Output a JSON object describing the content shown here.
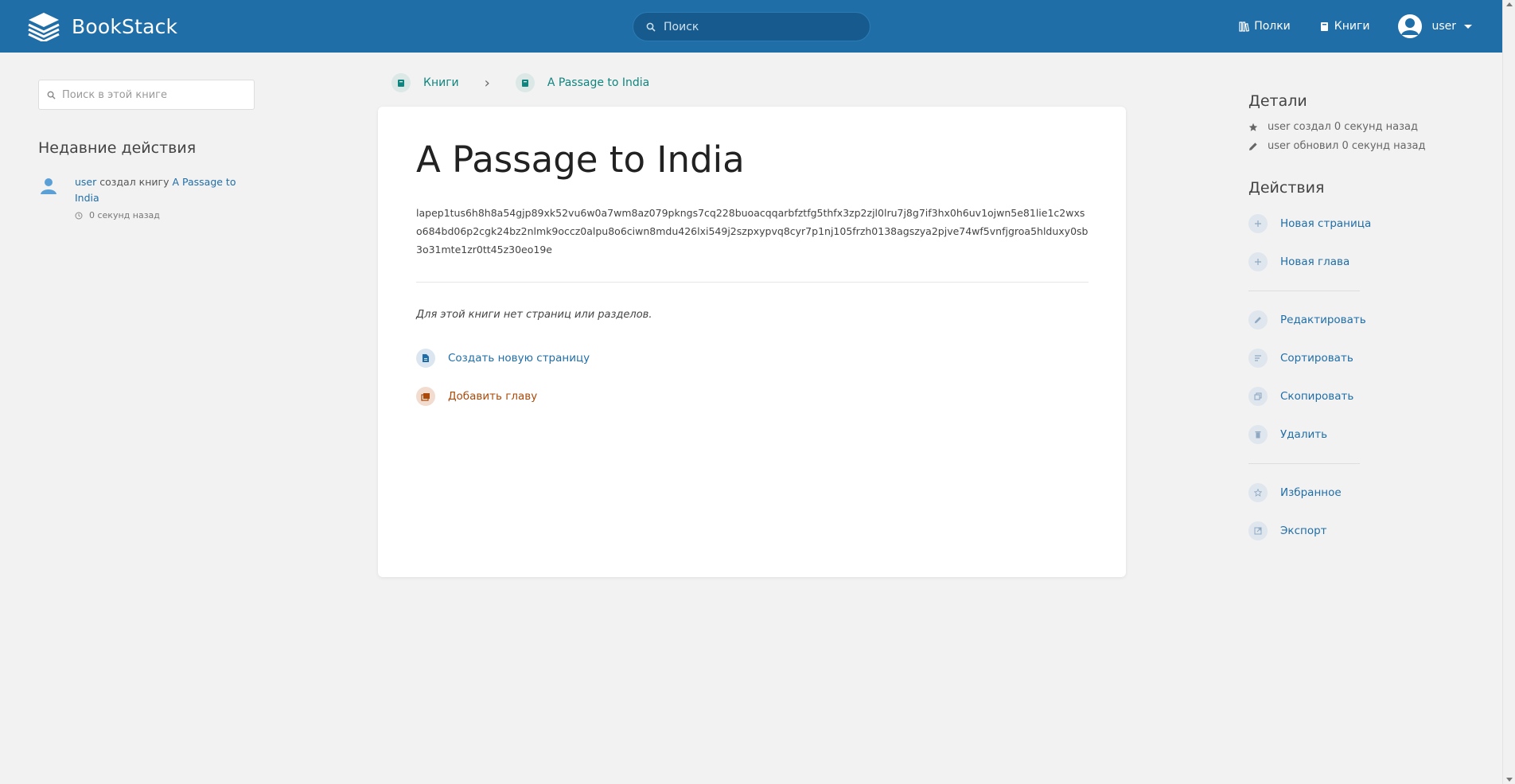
{
  "app": {
    "name": "BookStack"
  },
  "header": {
    "search_placeholder": "Поиск",
    "nav": [
      {
        "label": "Полки",
        "icon": "shelves-icon"
      },
      {
        "label": "Книги",
        "icon": "books-icon"
      }
    ],
    "user": {
      "name": "user"
    }
  },
  "left": {
    "book_search_placeholder": "Поиск в этой книге",
    "recent_title": "Недавние действия",
    "activity": {
      "user": "user",
      "action": "создал книгу",
      "target": "A Passage to India",
      "time": "0 секунд назад"
    }
  },
  "breadcrumb": {
    "items": [
      {
        "label": "Книги",
        "icon": "books-icon"
      },
      {
        "label": "A Passage to India",
        "icon": "book-icon"
      }
    ],
    "separator": "›"
  },
  "book": {
    "title": "A Passage to India",
    "description": "lapep1tus6h8h8a54gjp89xk52vu6w0a7wm8az079pkngs7cq228buoacqqarbfztfg5thfx3zp2zjl0lru7j8g7if3hx0h6uv1ojwn5e81lie1c2wxso684bd06p2cgk24bz2nlmk9occz0alpu8o6ciwn8mdu426lxi549j2szpxypvq8cyr7p1nj105frzh0138agszya2pjve74wf5vnfjgroa5hlduxy0sb3o31mte1zr0tt45z30eo19e",
    "empty_text": "Для этой книги нет страниц или разделов.",
    "create_page": "Создать новую страницу",
    "add_chapter": "Добавить главу"
  },
  "right": {
    "details_title": "Детали",
    "details": [
      {
        "text": "user создал 0 секунд назад",
        "icon": "star-icon"
      },
      {
        "text": "user обновил 0 секунд назад",
        "icon": "pencil-icon"
      }
    ],
    "actions_title": "Действия",
    "actions": {
      "new_page": "Новая страница",
      "new_chapter": "Новая глава",
      "edit": "Редактировать",
      "sort": "Сортировать",
      "copy": "Скопировать",
      "delete": "Удалить",
      "favourite": "Избранное",
      "export": "Экспорт"
    }
  },
  "colors": {
    "header_bg": "#206ea7",
    "link": "#206ea7",
    "book_teal": "#10857f",
    "chapter": "#a94a0b",
    "page_bg": "#f2f2f2"
  }
}
